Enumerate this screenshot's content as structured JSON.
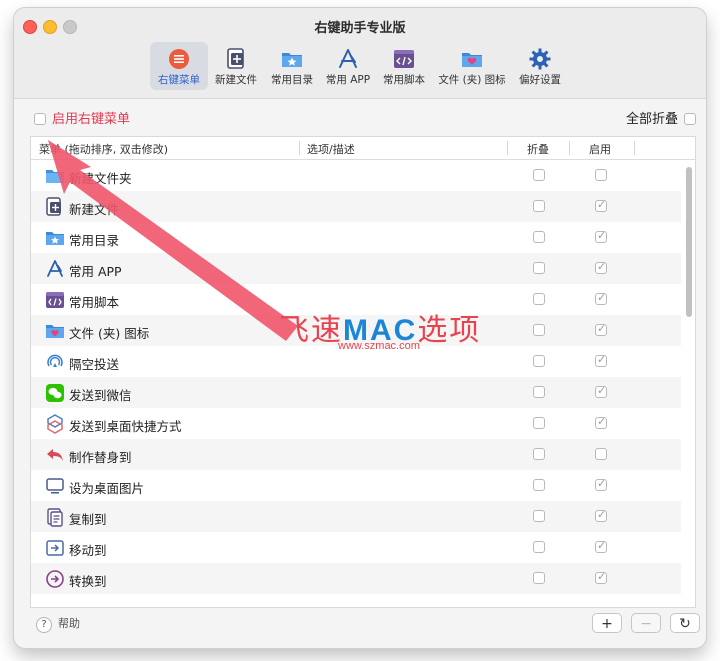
{
  "window": {
    "title": "右键助手专业版"
  },
  "toolbar": {
    "items": [
      {
        "label": "右键菜单",
        "icon": "menu-list-icon",
        "active": true
      },
      {
        "label": "新建文件",
        "icon": "new-file-icon"
      },
      {
        "label": "常用目录",
        "icon": "folder-star-icon"
      },
      {
        "label": "常用 APP",
        "icon": "app-store-icon"
      },
      {
        "label": "常用脚本",
        "icon": "script-icon"
      },
      {
        "label": "文件 (夹) 图标",
        "icon": "folder-heart-icon"
      },
      {
        "label": "偏好设置",
        "icon": "gear-icon"
      }
    ]
  },
  "options": {
    "enable_label": "启用右键菜单",
    "collapse_all_label": "全部折叠"
  },
  "table": {
    "headers": {
      "menu": "菜单 (拖动排序, 双击修改)",
      "options": "选项/描述",
      "collapse": "折叠",
      "enabled": "启用"
    },
    "rows": [
      {
        "label": "新建文件夹",
        "icon": "folder-icon",
        "collapse": false,
        "enabled": false
      },
      {
        "label": "新建文件",
        "icon": "new-file-icon",
        "collapse": false,
        "enabled": true
      },
      {
        "label": "常用目录",
        "icon": "folder-star-icon",
        "collapse": false,
        "enabled": true
      },
      {
        "label": "常用 APP",
        "icon": "app-store-icon",
        "collapse": false,
        "enabled": true
      },
      {
        "label": "常用脚本",
        "icon": "script-icon",
        "collapse": false,
        "enabled": true
      },
      {
        "label": "文件 (夹) 图标",
        "icon": "folder-heart-icon",
        "collapse": false,
        "enabled": true
      },
      {
        "label": "隔空投送",
        "icon": "airdrop-icon",
        "collapse": false,
        "enabled": true
      },
      {
        "label": "发送到微信",
        "icon": "wechat-icon",
        "collapse": false,
        "enabled": true
      },
      {
        "label": "发送到桌面快捷方式",
        "icon": "shortcut-icon",
        "collapse": false,
        "enabled": true
      },
      {
        "label": "制作替身到",
        "icon": "alias-arrow-icon",
        "collapse": false,
        "enabled": false
      },
      {
        "label": "设为桌面图片",
        "icon": "monitor-icon",
        "collapse": false,
        "enabled": true
      },
      {
        "label": "复制到",
        "icon": "copy-icon",
        "collapse": false,
        "enabled": true
      },
      {
        "label": "移动到",
        "icon": "move-icon",
        "collapse": false,
        "enabled": true
      },
      {
        "label": "转换到",
        "icon": "convert-icon",
        "collapse": false,
        "enabled": true
      }
    ]
  },
  "footer": {
    "help_label": "帮助",
    "add": "+",
    "remove": "−",
    "refresh": "↻"
  },
  "watermark": {
    "text_a": "飞速",
    "text_mac": "MAC",
    "text_b": "选项",
    "url": "www.szmac.com"
  },
  "colors": {
    "accent": "#2f63c9",
    "enable_label": "#e53a53",
    "arrow": "#f0566a"
  }
}
